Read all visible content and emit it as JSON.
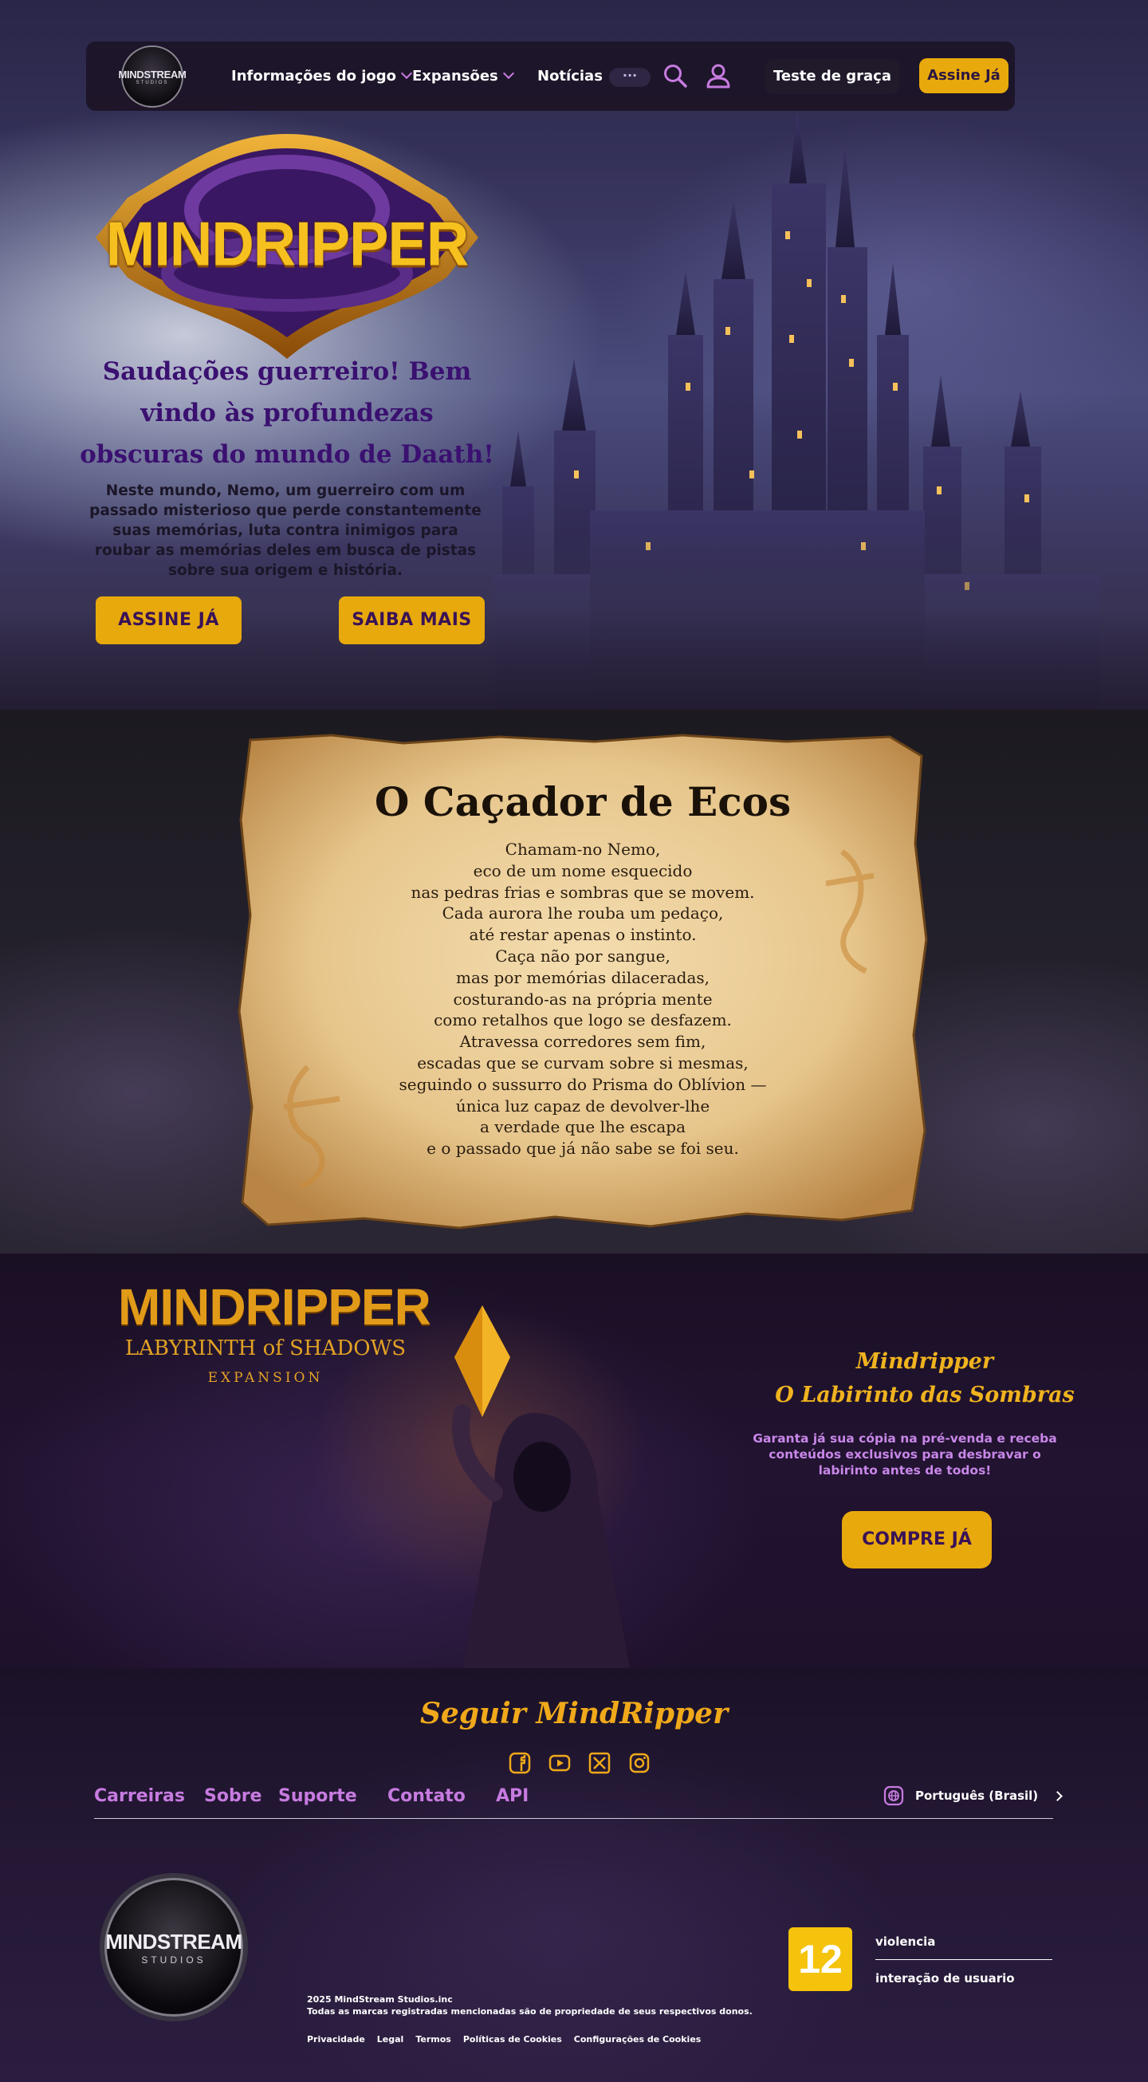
{
  "nav": {
    "logo_line1": "MINDSTREAM",
    "logo_line2": "STUDIOS",
    "items": [
      {
        "label": "Informações do jogo"
      },
      {
        "label": "Expansões"
      },
      {
        "label": "Notícias"
      }
    ],
    "more_label": "···",
    "icons": [
      "search-icon",
      "user-icon"
    ],
    "trial_label": "Teste de graça",
    "subscribe_label": "Assine Já"
  },
  "hero": {
    "game_logo": "MINDRIPPER",
    "title": "Saudações guerreiro! Bem vindo às profundezas obscuras do mundo de Daath!",
    "description": "Neste mundo, Nemo, um guerreiro com um passado misterioso que perde constantemente suas memórias, luta contra inimigos para roubar as memórias deles em busca de pistas sobre sua origem e história.",
    "btn_subscribe": "ASSINE JÁ",
    "btn_more": "SAIBA MAIS"
  },
  "poem": {
    "title": "O Caçador de Ecos",
    "lines": [
      "Chamam-no Nemo,",
      "eco de um nome esquecido",
      "nas pedras frias e sombras que se movem.",
      "Cada aurora lhe rouba um pedaço,",
      "até restar apenas o instinto.",
      "Caça não por sangue,",
      "mas por memórias dilaceradas,",
      "costurando-as na própria mente",
      "como retalhos que logo se desfazem.",
      "Atravessa corredores sem fim,",
      "escadas que se curvam sobre si mesmas,",
      "seguindo o sussurro do Prisma do Oblívion —",
      "única luz capaz de devolver-lhe",
      "a verdade que lhe escapa",
      "e o passado que já não sabe se foi seu."
    ]
  },
  "expansion": {
    "logo_title": "MINDRIPPER",
    "logo_subtitle": "LABYRINTH of SHADOWS",
    "logo_small": "EXPANSION",
    "title_line1": "Mindripper",
    "title_line2": "O Labirinto das Sombras",
    "description": "Garanta já sua cópia na pré-venda e receba conteúdos exclusivos para desbravar o labirinto antes de todos!",
    "button": "COMPRE JÁ"
  },
  "footer": {
    "follow_title": "Seguir MindRipper",
    "socials": [
      "facebook-icon",
      "youtube-icon",
      "x-icon",
      "instagram-icon"
    ],
    "links": [
      {
        "label": "Carreiras"
      },
      {
        "label": "Sobre"
      },
      {
        "label": "Suporte"
      },
      {
        "label": "Contato"
      },
      {
        "label": "API"
      }
    ],
    "language": "Português (Brasil)",
    "logo_line1": "MINDSTREAM",
    "logo_line2": "STUDIOS",
    "copyright": "2025 MindStream Studios.inc",
    "rights": "Todas as marcas registradas mencionadas são de propriedade de seus respectivos donos.",
    "legal_links": [
      "Privacidade",
      "Legal",
      "Termos",
      "Políticas de Cookies",
      "Configurações de Cookies"
    ],
    "rating": "12",
    "descriptor1": "violencia",
    "descriptor2": "interação de usuario"
  },
  "colors": {
    "accent_gold": "#e8a90c",
    "accent_purple": "#c77be0",
    "dark_bg": "#17101f"
  }
}
